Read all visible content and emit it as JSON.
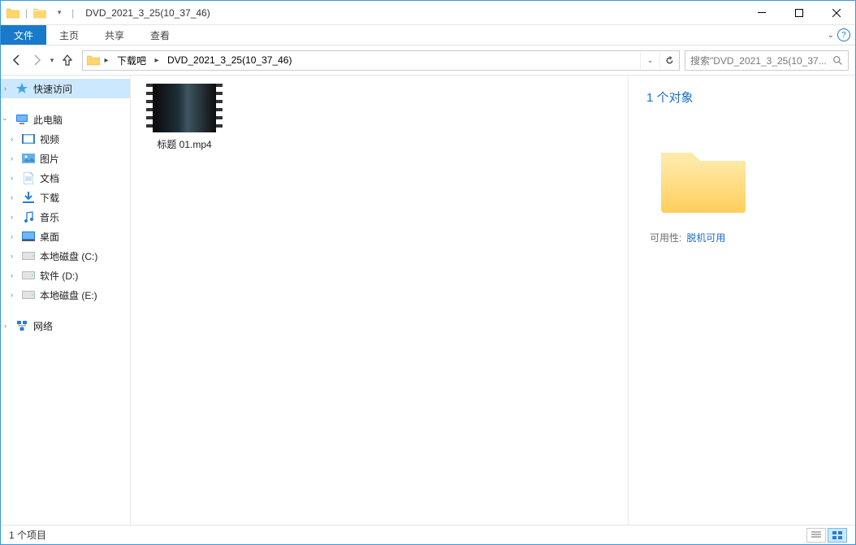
{
  "title": "DVD_2021_3_25(10_37_46)",
  "qat": {
    "divider": "|"
  },
  "ribbon": {
    "file_tab": "文件",
    "tabs": [
      "主页",
      "共享",
      "查看"
    ]
  },
  "nav": {
    "breadcrumbs": [
      "下载吧",
      "DVD_2021_3_25(10_37_46)"
    ],
    "search_placeholder": "搜索\"DVD_2021_3_25(10_37..."
  },
  "sidebar": {
    "quick_access": "快速访问",
    "this_pc": "此电脑",
    "items": [
      "视频",
      "图片",
      "文档",
      "下载",
      "音乐",
      "桌面",
      "本地磁盘 (C:)",
      "软件 (D:)",
      "本地磁盘 (E:)"
    ],
    "network": "网络"
  },
  "file": {
    "name": "标题 01.mp4"
  },
  "details": {
    "title": "1 个对象",
    "prop_label": "可用性:",
    "prop_value": "脱机可用"
  },
  "status": {
    "text": "1 个项目"
  }
}
